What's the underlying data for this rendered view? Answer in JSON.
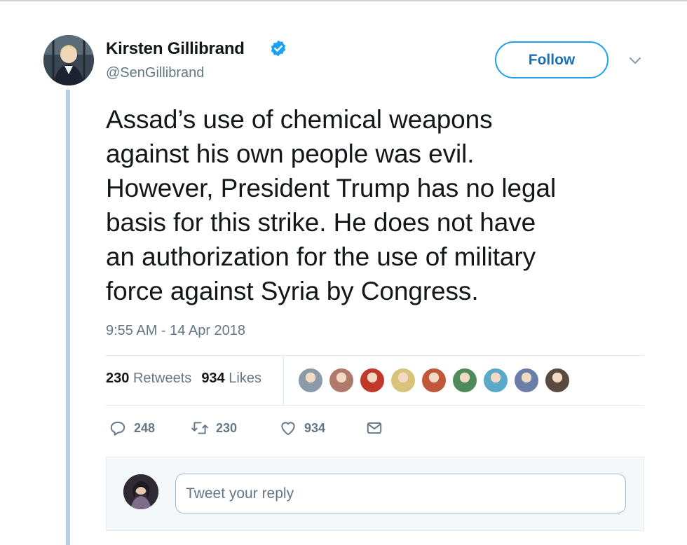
{
  "author": {
    "display_name": "Kirsten Gillibrand",
    "handle": "@SenGillibrand",
    "verified": true
  },
  "header": {
    "follow_label": "Follow",
    "menu_icon": "chevron-down-icon"
  },
  "tweet": {
    "lines": [
      "Assad’s use of chemical weapons",
      "against his own people was evil.",
      "However, President Trump has no legal",
      "basis for this strike. He does not have",
      "an authorization for the use of military",
      "force against Syria by Congress."
    ],
    "timestamp": "9:55 AM - 14 Apr 2018"
  },
  "stats": {
    "retweets_count": "230",
    "retweets_label": "Retweets",
    "likes_count": "934",
    "likes_label": "Likes"
  },
  "liker_avatars": [
    {
      "name": "liker-1",
      "color": "#8a9aa8"
    },
    {
      "name": "liker-2",
      "color": "#b07a6a"
    },
    {
      "name": "liker-3",
      "color": "#c0392b"
    },
    {
      "name": "liker-4",
      "color": "#d9c27a"
    },
    {
      "name": "liker-5",
      "color": "#c0563a"
    },
    {
      "name": "liker-6",
      "color": "#4e8a5a"
    },
    {
      "name": "liker-7",
      "color": "#5aa9c9"
    },
    {
      "name": "liker-8",
      "color": "#6a7fa8"
    },
    {
      "name": "liker-9",
      "color": "#5a4a40"
    }
  ],
  "actions": {
    "reply_count": "248",
    "retweet_count": "230",
    "like_count": "934"
  },
  "reply": {
    "placeholder": "Tweet your reply"
  },
  "colors": {
    "accent": "#1da1f2",
    "thread_line": "#b8cfe3",
    "secondary_text": "#657786"
  }
}
